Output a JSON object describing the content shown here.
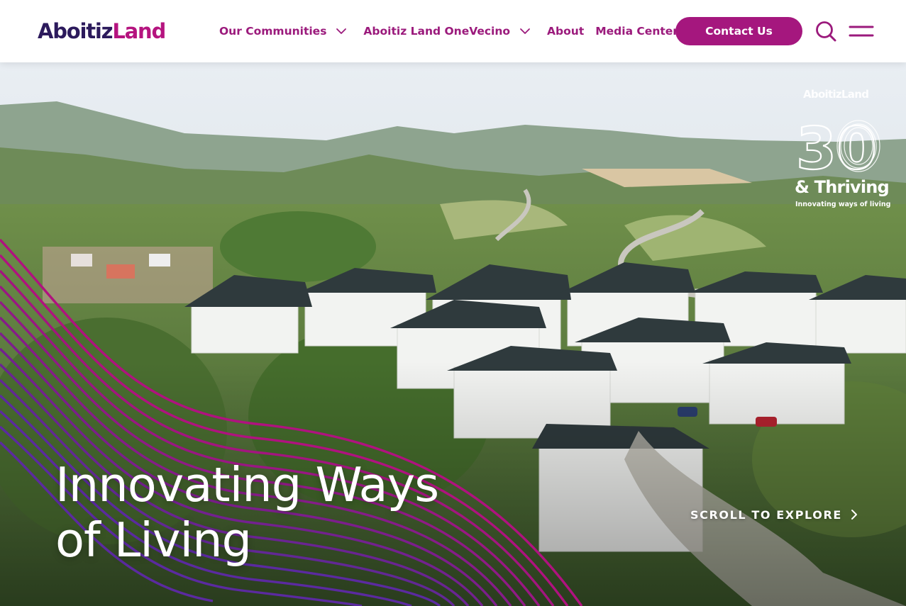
{
  "brand": {
    "part1": "Aboitiz",
    "part2": "Land",
    "color_dark": "#2c1a5c",
    "color_accent": "#b5147f"
  },
  "nav": {
    "items": [
      {
        "label": "Our Communities",
        "has_dropdown": true
      },
      {
        "label": "Aboitiz Land OneVecino",
        "has_dropdown": true
      },
      {
        "label": "About",
        "has_dropdown": false
      },
      {
        "label": "Media Center",
        "has_dropdown": false
      }
    ],
    "contact_label": "Contact Us",
    "search_icon": "search-icon",
    "menu_icon": "hamburger-menu-icon",
    "color": "#9b1a7c"
  },
  "hero": {
    "headline_line1": "Innovating Ways",
    "headline_line2": "of Living",
    "scroll_label": "SCROLL TO EXPLORE",
    "scroll_icon": "chevron-right-icon",
    "badge": {
      "brand": "AboitizLand",
      "number": "30",
      "title": "& Thriving",
      "tagline": "Innovating ways of living"
    },
    "wave_colors": [
      "#b0127f",
      "#7a1d8e",
      "#5b2aa0"
    ]
  }
}
